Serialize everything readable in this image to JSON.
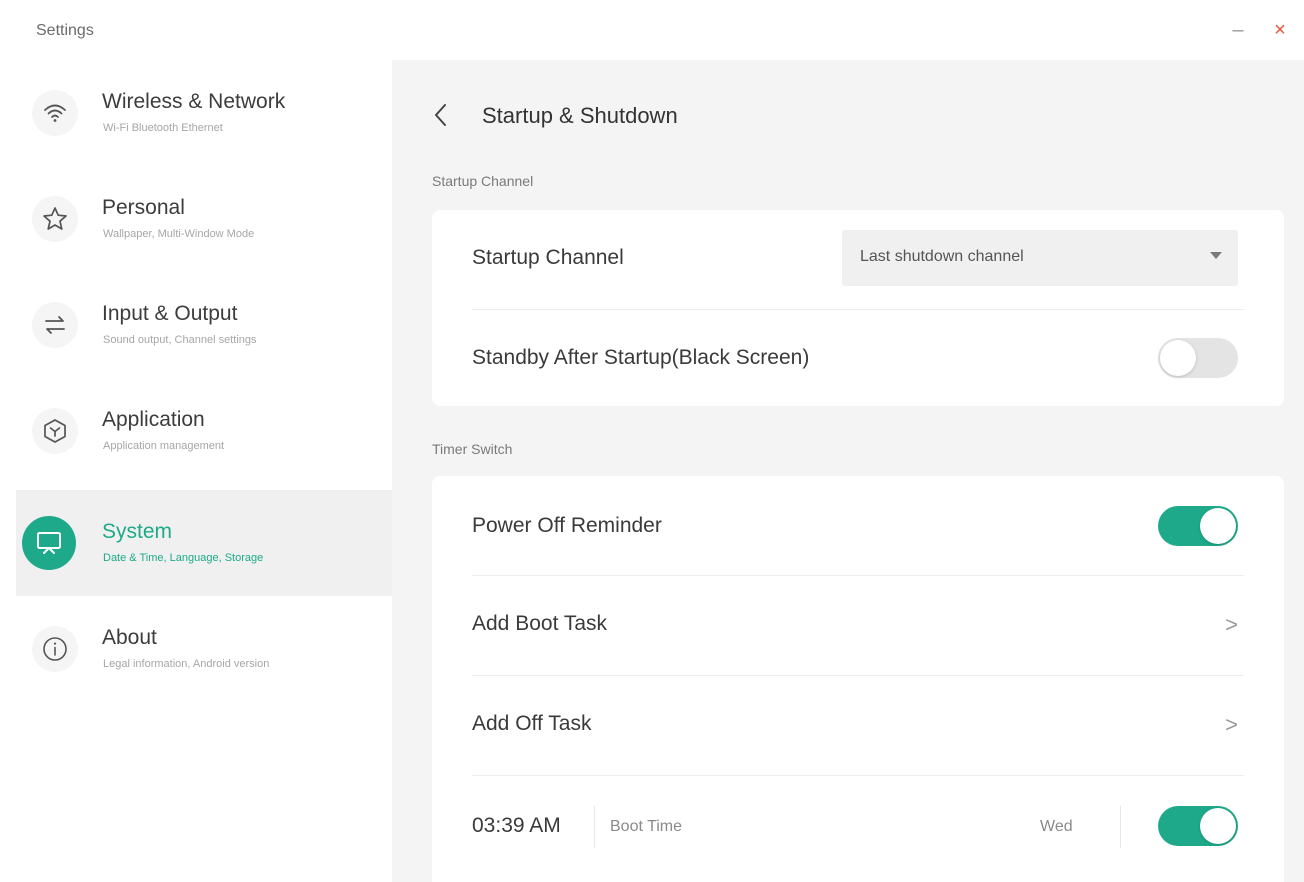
{
  "window": {
    "title": "Settings",
    "minimize_glyph": "–",
    "close_glyph": "×"
  },
  "accent_color": "#1eaa8a",
  "sidebar": {
    "items": [
      {
        "label": "Wireless & Network",
        "subtitle": "Wi-Fi Bluetooth Ethernet",
        "icon": "wifi-icon",
        "active": false
      },
      {
        "label": "Personal",
        "subtitle": "Wallpaper, Multi-Window Mode",
        "icon": "star-icon",
        "active": false
      },
      {
        "label": "Input & Output",
        "subtitle": "Sound output, Channel settings",
        "icon": "swap-arrows-icon",
        "active": false
      },
      {
        "label": "Application",
        "subtitle": "Application management",
        "icon": "app-cube-icon",
        "active": false
      },
      {
        "label": "System",
        "subtitle": "Date & Time, Language, Storage",
        "icon": "monitor-icon",
        "active": true
      },
      {
        "label": "About",
        "subtitle": "Legal information, Android version",
        "icon": "info-icon",
        "active": false
      }
    ]
  },
  "main": {
    "page_title": "Startup & Shutdown",
    "startup_section": {
      "title": "Startup Channel",
      "channel_label": "Startup Channel",
      "channel_value": "Last shutdown channel",
      "standby_label": "Standby After Startup(Black Screen)",
      "standby_enabled": false
    },
    "timer_section": {
      "title": "Timer Switch",
      "power_off_reminder_label": "Power Off Reminder",
      "power_off_reminder_enabled": true,
      "add_boot_task_label": "Add Boot Task",
      "add_off_task_label": "Add Off Task",
      "task": {
        "time": "03:39 AM",
        "type": "Boot Time",
        "day": "Wed",
        "enabled": true
      },
      "chevron_glyph": ">"
    }
  }
}
